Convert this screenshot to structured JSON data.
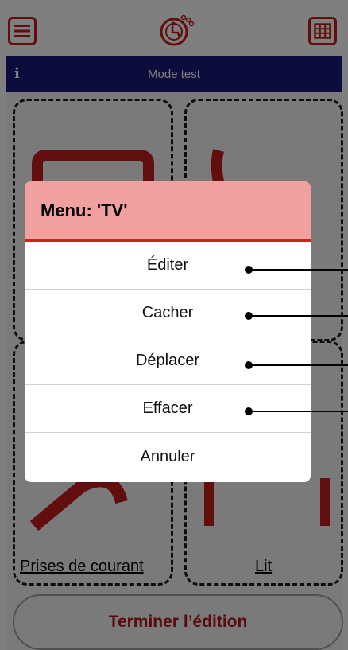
{
  "infobar": {
    "text": "Mode test"
  },
  "tiles": [
    {
      "label": "Prises de courant"
    },
    {
      "label": "Lit"
    }
  ],
  "finish_button": {
    "label": "Terminer l’édition"
  },
  "menu": {
    "title": "Menu: 'TV'",
    "items": [
      {
        "label": "Éditer"
      },
      {
        "label": "Cacher"
      },
      {
        "label": "Déplacer"
      },
      {
        "label": "Effacer"
      },
      {
        "label": "Annuler"
      }
    ]
  },
  "colors": {
    "accent": "#c41c1c",
    "infobar": "#1a1a7a",
    "menu_header": "#f1a0a0"
  },
  "icons": [
    "menu-icon",
    "wheelchair-logo-icon",
    "grid-icon",
    "info-icon",
    "tv-icon",
    "remote-icon",
    "plug-icon",
    "bed-icon"
  ]
}
